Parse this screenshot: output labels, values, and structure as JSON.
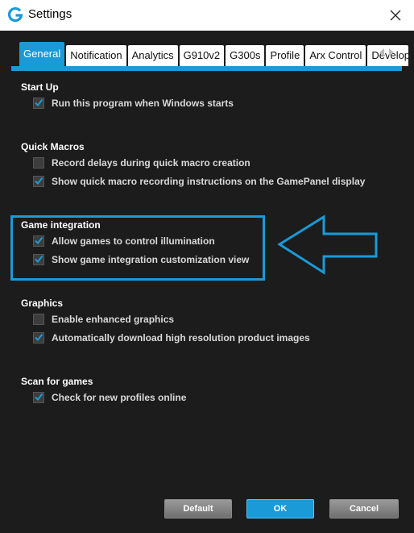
{
  "window": {
    "title": "Settings",
    "app_icon": "logitech-g-icon",
    "close_icon": "close-icon"
  },
  "tabs": [
    {
      "label": "General",
      "active": true
    },
    {
      "label": "Notification",
      "active": false
    },
    {
      "label": "Analytics",
      "active": false
    },
    {
      "label": "G910v2",
      "active": false
    },
    {
      "label": "G300s",
      "active": false
    },
    {
      "label": "Profile",
      "active": false
    },
    {
      "label": "Arx Control",
      "active": false
    },
    {
      "label": "Developer",
      "active": false
    }
  ],
  "tab_scroll": {
    "left_icon": "scroll-left-icon",
    "right_icon": "scroll-right-icon"
  },
  "sections": [
    {
      "title": "Start Up",
      "options": [
        {
          "label": "Run this program when Windows starts",
          "checked": true
        }
      ]
    },
    {
      "title": "Quick Macros",
      "options": [
        {
          "label": "Record delays during quick macro creation",
          "checked": false
        },
        {
          "label": "Show quick macro recording instructions on the GamePanel display",
          "checked": true
        }
      ]
    },
    {
      "title": "Game integration",
      "options": [
        {
          "label": "Allow games to control illumination",
          "checked": true
        },
        {
          "label": "Show game integration customization view",
          "checked": true
        }
      ]
    },
    {
      "title": "Graphics",
      "options": [
        {
          "label": "Enable enhanced graphics",
          "checked": false
        },
        {
          "label": "Automatically download high resolution product images",
          "checked": true
        }
      ]
    },
    {
      "title": "Scan for games",
      "options": [
        {
          "label": "Check for new profiles online",
          "checked": true
        }
      ]
    }
  ],
  "buttons": {
    "default": "Default",
    "ok": "OK",
    "cancel": "Cancel"
  },
  "colors": {
    "accent": "#1a9ad7",
    "background": "#1c1c1c",
    "annotation": "#1a9ad7"
  }
}
